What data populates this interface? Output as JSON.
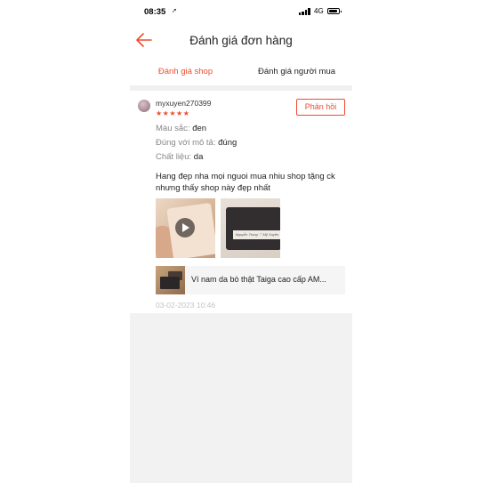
{
  "status_bar": {
    "time": "08:35",
    "network": "4G"
  },
  "header": {
    "title": "Đánh giá đơn hàng",
    "accent_color": "#ee4d2d"
  },
  "tabs": [
    {
      "label": "Đánh giá shop",
      "active": true
    },
    {
      "label": "Đánh giá người mua",
      "active": false
    }
  ],
  "review": {
    "username": "myxuyen270399",
    "rating": 5,
    "stars": "★★★★★",
    "reply_label": "Phản hồi",
    "attributes": {
      "color_label": "Màu sắc:",
      "color_value": "đen",
      "desc_label": "Đúng với mô tả:",
      "desc_value": "đúng",
      "material_label": "Chất liệu:",
      "material_value": "da"
    },
    "text": "Hang đẹp nha mọi nguoi mua nhiu shop tặng ck nhưng thấy shop này đẹp nhất",
    "wallet_tag_text": "Nguyễn Trung ♡ Mỹ Xuyên",
    "product_name": "Ví nam da bò thật Taiga cao cấp AM...",
    "timestamp": "03-02-2023 10:46"
  }
}
